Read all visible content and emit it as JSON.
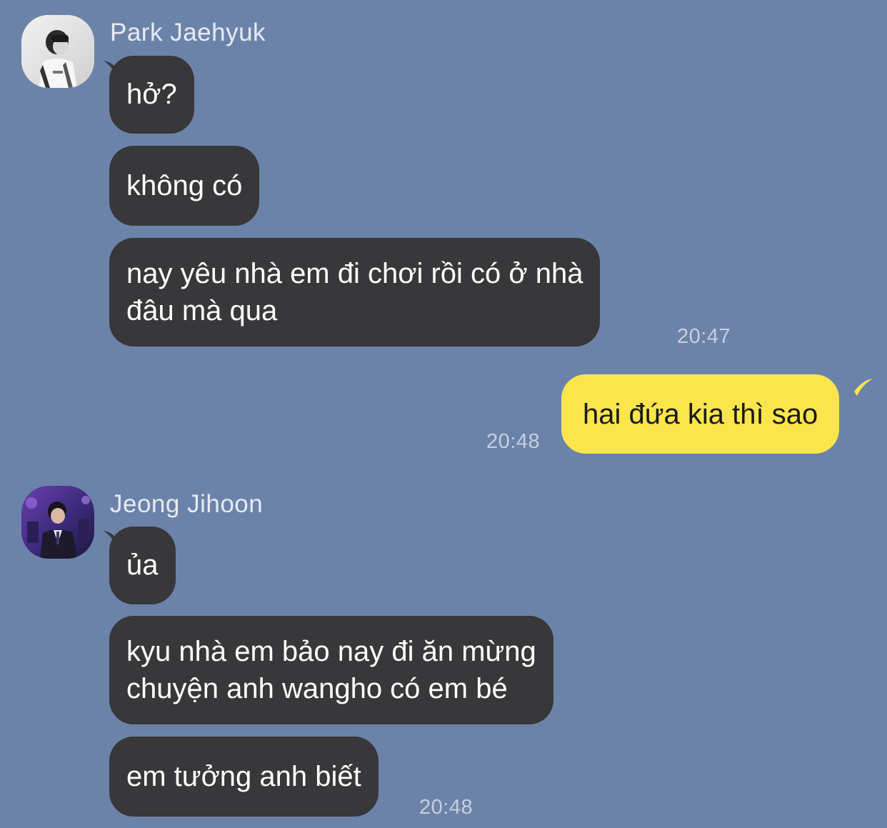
{
  "conversation": {
    "groups": [
      {
        "sender": "Park Jaehyuk",
        "avatar_icon": "profile-photo-grayscale-icon",
        "messages": [
          "hở?",
          "không có",
          "nay yêu nhà em đi chơi rồi có ở nhà\nđâu mà qua"
        ],
        "time": "20:47"
      },
      {
        "sender": "me",
        "messages": [
          "hai đứa kia thì sao"
        ],
        "time": "20:48"
      },
      {
        "sender": "Jeong Jihoon",
        "avatar_icon": "profile-photo-purple-icon",
        "messages": [
          "ủa",
          "kyu nhà em bảo nay đi ăn mừng\nchuyện anh wangho có em bé",
          "em tưởng anh biết"
        ],
        "time": "20:48"
      }
    ]
  },
  "colors": {
    "background": "#6c83a9",
    "incoming_bubble": "#383739",
    "outgoing_bubble": "#fbe54d",
    "timestamp": "#c5cfde",
    "sender_name": "#e6ebf3"
  }
}
